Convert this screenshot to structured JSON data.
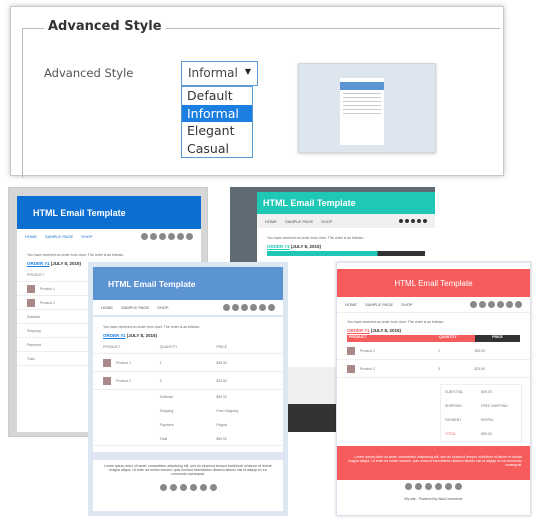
{
  "settings": {
    "section_title": "Advanced Style",
    "field_label": "Advanced Style",
    "select_value": "Informal",
    "options": [
      "Default",
      "Informal",
      "Elegant",
      "Casual"
    ],
    "selected_option": "Informal"
  },
  "email": {
    "title": "HTML Email Template",
    "nav": [
      "HOME",
      "SAMPLE PAGE",
      "SHOP"
    ],
    "intro": "You have received an order from User. The order is as follows:",
    "order_link": "ORDER #1",
    "order_date": "(JULY 8, 2015)",
    "columns": [
      "PRODUCT",
      "QUANTITY",
      "PRICE"
    ],
    "products": [
      {
        "name": "Product 1",
        "qty": "1",
        "price": "$35.50"
      },
      {
        "name": "Product 2",
        "qty": "3",
        "price": "$23.50"
      }
    ],
    "totals": [
      {
        "label": "Subtotal",
        "value": "$59.00"
      },
      {
        "label": "Shipping",
        "value": "Free Shipping"
      },
      {
        "label": "Payment",
        "value": "Paypal"
      },
      {
        "label": "Total",
        "value": "$59.00"
      }
    ],
    "totals_upper": [
      {
        "label": "SUBTOTAL",
        "value": "$59.00"
      },
      {
        "label": "SHIPPING",
        "value": "FREE SHIPPING"
      },
      {
        "label": "PAYMENT",
        "value": "PAYPAL"
      },
      {
        "label": "TOTAL",
        "value": "$59.00"
      }
    ],
    "lorem": "Lorem ipsum dolor sit amet, consectetur adipiscing elit, sed do eiusmod tempor incididunt ut labore et dolore magna aliqua. Ut enim ad minim veniam, quis nostrud exercitation ullamco laboris nisi ut aliquip ex ea commodo consequat.",
    "footer": "My site - Powered by WooCommerce",
    "footer_short": "My site"
  },
  "colors": {
    "default": "#0b6fd1",
    "elegant": "#1ec8b5",
    "informal": "#5b93d3",
    "casual": "#f75c5c"
  }
}
